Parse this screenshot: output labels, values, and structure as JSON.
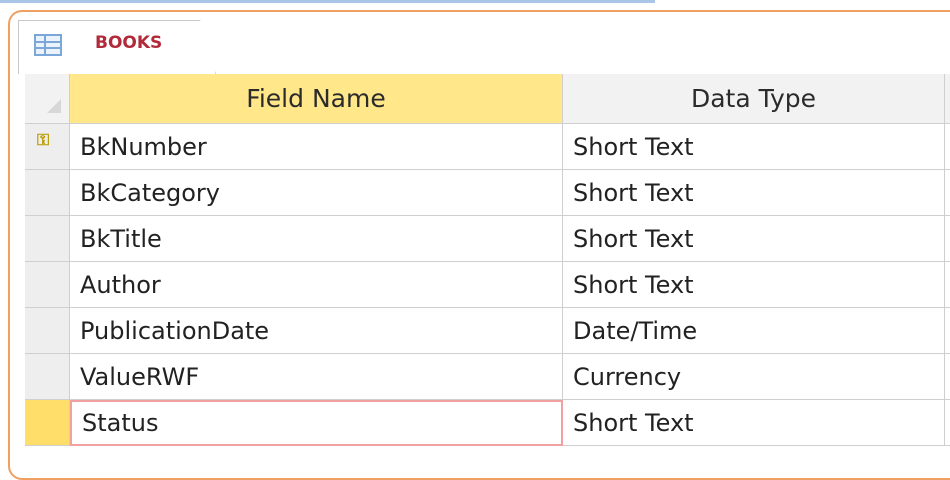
{
  "tab": {
    "title": "BOOKS",
    "icon": "table-icon"
  },
  "columns": {
    "field_name": "Field Name",
    "data_type": "Data Type"
  },
  "rows": [
    {
      "field": "BkNumber",
      "type": "Short Text",
      "primary_key": true
    },
    {
      "field": "BkCategory",
      "type": "Short Text"
    },
    {
      "field": "BkTitle",
      "type": "Short Text"
    },
    {
      "field": "Author",
      "type": "Short Text"
    },
    {
      "field": "PublicationDate",
      "type": "Date/Time"
    },
    {
      "field": "ValueRWF",
      "type": "Currency"
    },
    {
      "field": "Status",
      "type": "Short Text"
    }
  ],
  "colors": {
    "tab_label": "#b12a3a",
    "field_header_highlight": "#ffe78a",
    "active_row_selector": "#ffde6a",
    "frame_accent": "#f0a060"
  }
}
